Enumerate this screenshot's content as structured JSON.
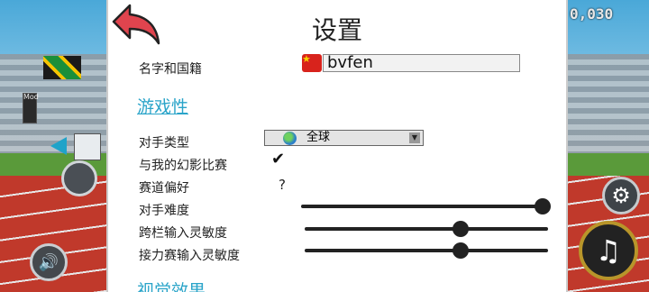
{
  "hud": {
    "score": "0,030",
    "mod_tag": "Mod"
  },
  "icons": {
    "back": "back-arrow-icon",
    "sound": "speaker-icon",
    "gear": "gear-icon",
    "music": "music-note-icon",
    "globe": "globe-icon",
    "check": "checkmark-icon"
  },
  "settings": {
    "title": "设置",
    "name_label": "名字和国籍",
    "name_value": "bvfen",
    "section_gameplay": "游戏性",
    "opponent_type_label": "对手类型",
    "opponent_type_value": "全球",
    "ghost_race_label": "与我的幻影比赛",
    "ghost_race_checked": true,
    "track_pref_label": "赛道偏好",
    "track_pref_value": "?",
    "difficulty_label": "对手难度",
    "difficulty_level": 0.97,
    "hurdle_sens_label": "跨栏输入灵敏度",
    "hurdle_sens_level": 0.64,
    "relay_sens_label": "接力赛输入灵敏度",
    "relay_sens_level": 0.64,
    "section_visual": "视觉效果"
  },
  "colors": {
    "accent": "#2aa4c9",
    "back_arrow": "#e0444e",
    "panel_bg": "#ffffff"
  }
}
